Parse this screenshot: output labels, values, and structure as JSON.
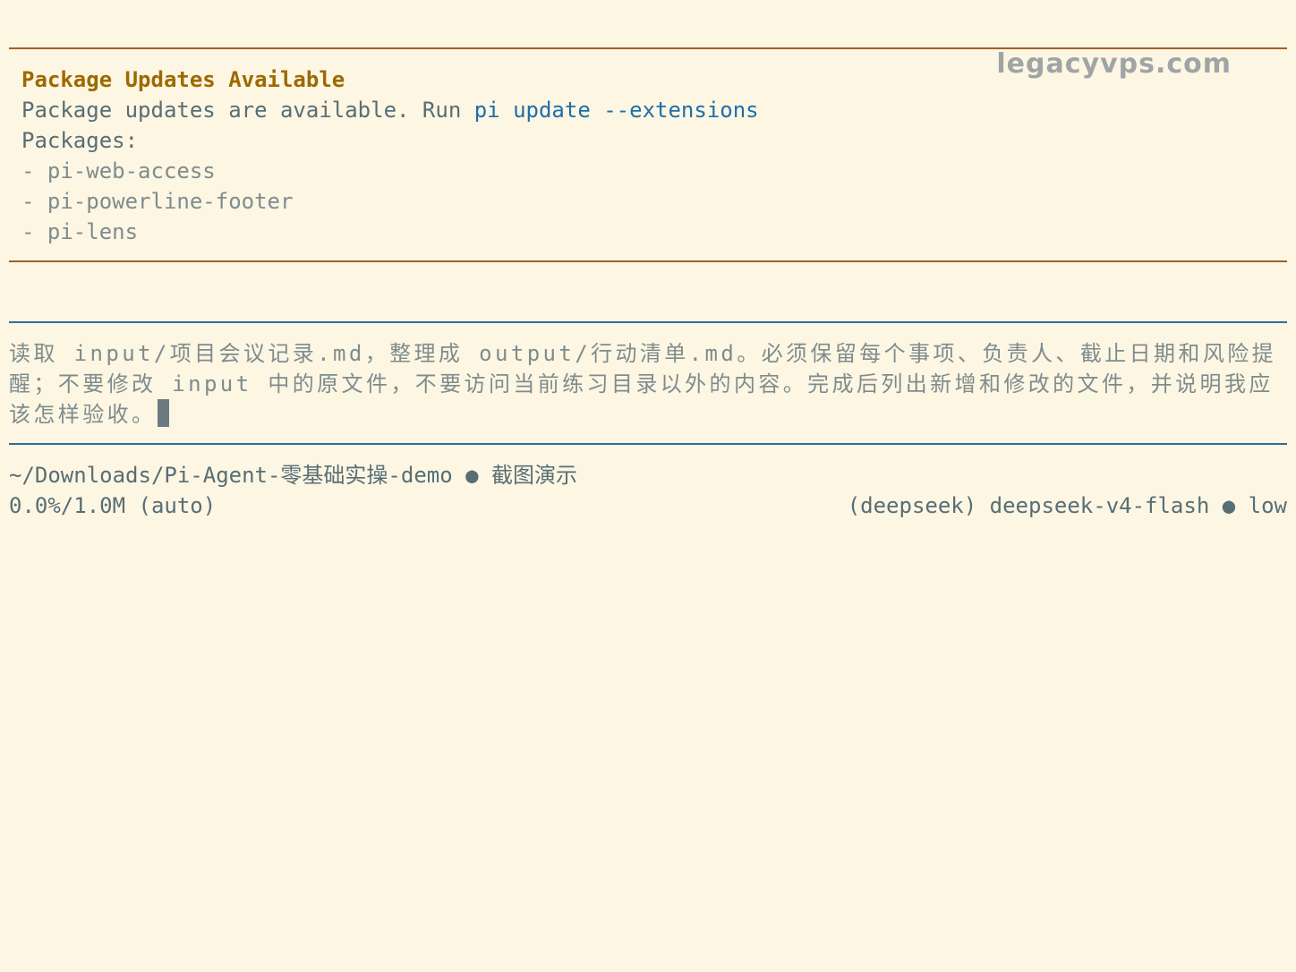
{
  "watermark": "legacyvps.com",
  "update_notice": {
    "title": "Package Updates Available",
    "message_prefix": "Package updates are available. Run ",
    "command": "pi update --extensions",
    "packages_label": "Packages:",
    "packages": [
      "- pi-web-access",
      "- pi-powerline-footer",
      "- pi-lens"
    ]
  },
  "prompt": {
    "text": "读取 input/项目会议记录.md，整理成 output/行动清单.md。必须保留每个事项、负责人、截止日期和风险提醒；不要修改 input 中的原文件，不要访问当前练习目录以外的内容。完成后列出新增和修改的文件，并说明我应该怎样验收。"
  },
  "footer": {
    "cwd": "~/Downloads/Pi-Agent-零基础实操-demo",
    "separator": "●",
    "session": "截图演示",
    "usage": "0.0%/1.0M (auto)",
    "model_provider": "(deepseek) deepseek-v4-flash",
    "thinking_level": "low"
  },
  "colors": {
    "background": "#fdf6e3",
    "title": "#9c6a00",
    "command": "#1f6eaa",
    "rule_top": "#a0612a",
    "rule_input": "#2f6d9c"
  }
}
